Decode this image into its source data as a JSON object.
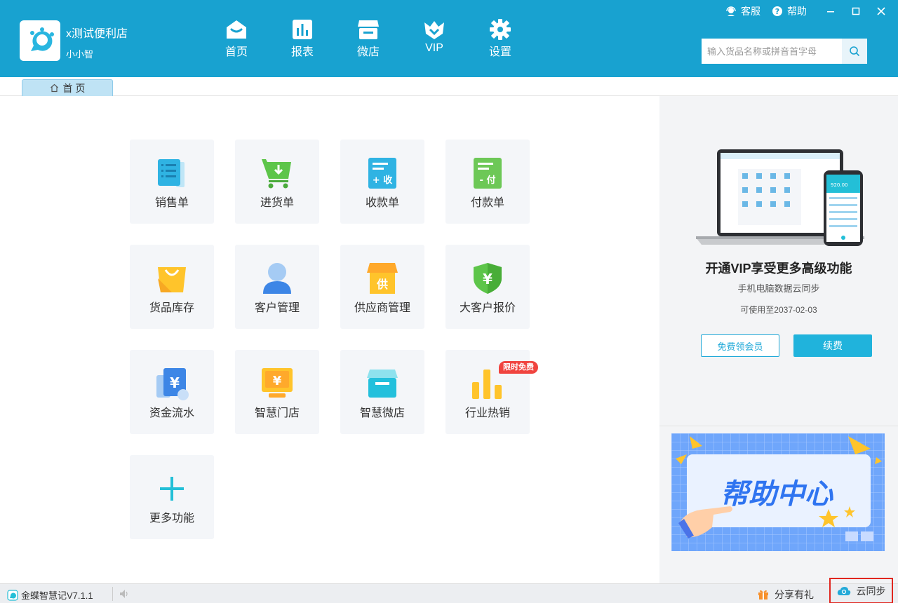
{
  "header": {
    "shop_name": "x测试便利店",
    "user_name": "小小智",
    "nav": [
      {
        "label": "首页",
        "icon": "home-icon"
      },
      {
        "label": "报表",
        "icon": "report-icon"
      },
      {
        "label": "微店",
        "icon": "store-icon"
      },
      {
        "label": "VIP",
        "icon": "vip-icon"
      },
      {
        "label": "设置",
        "icon": "gear-icon"
      }
    ],
    "links": {
      "service": "客服",
      "help": "帮助"
    },
    "search_placeholder": "输入货品名称或拼音首字母"
  },
  "tabs": [
    {
      "label": "首 页",
      "icon": "home-outline-icon"
    }
  ],
  "tiles": [
    {
      "label": "销售单",
      "icon": "sales-order-icon"
    },
    {
      "label": "进货单",
      "icon": "purchase-cart-icon"
    },
    {
      "label": "收款单",
      "icon": "receipt-icon",
      "glyph": "+ 收"
    },
    {
      "label": "付款单",
      "icon": "payment-icon",
      "glyph": "- 付"
    },
    {
      "label": "货品库存",
      "icon": "shopping-bag-icon"
    },
    {
      "label": "客户管理",
      "icon": "customer-icon"
    },
    {
      "label": "供应商管理",
      "icon": "supplier-shop-icon",
      "glyph": "供"
    },
    {
      "label": "大客户报价",
      "icon": "shield-yen-icon",
      "glyph": "¥"
    },
    {
      "label": "资金流水",
      "icon": "wallet-yen-icon",
      "glyph": "¥"
    },
    {
      "label": "智慧门店",
      "icon": "monitor-yen-icon",
      "glyph": "¥"
    },
    {
      "label": "智慧微店",
      "icon": "micro-store-icon"
    },
    {
      "label": "行业热销",
      "icon": "bar-chart-icon",
      "badge": "限时免费"
    },
    {
      "label": "更多功能",
      "icon": "plus-icon"
    }
  ],
  "vip": {
    "title": "开通VIP享受更多高级功能",
    "subtitle": "手机电脑数据云同步",
    "expiry": "可使用至2037-02-03",
    "free_button": "免费领会员",
    "renew_button": "续费",
    "phone_amount": "920.00"
  },
  "help_banner": {
    "text": "帮助中心"
  },
  "statusbar": {
    "version": "金蝶智慧记V7.1.1",
    "share": "分享有礼",
    "sync": "云同步"
  },
  "colors": {
    "primary": "#18a2d0",
    "accent_button": "#20b3dc",
    "badge": "#f0443f",
    "highlight_border": "#e0261f"
  }
}
